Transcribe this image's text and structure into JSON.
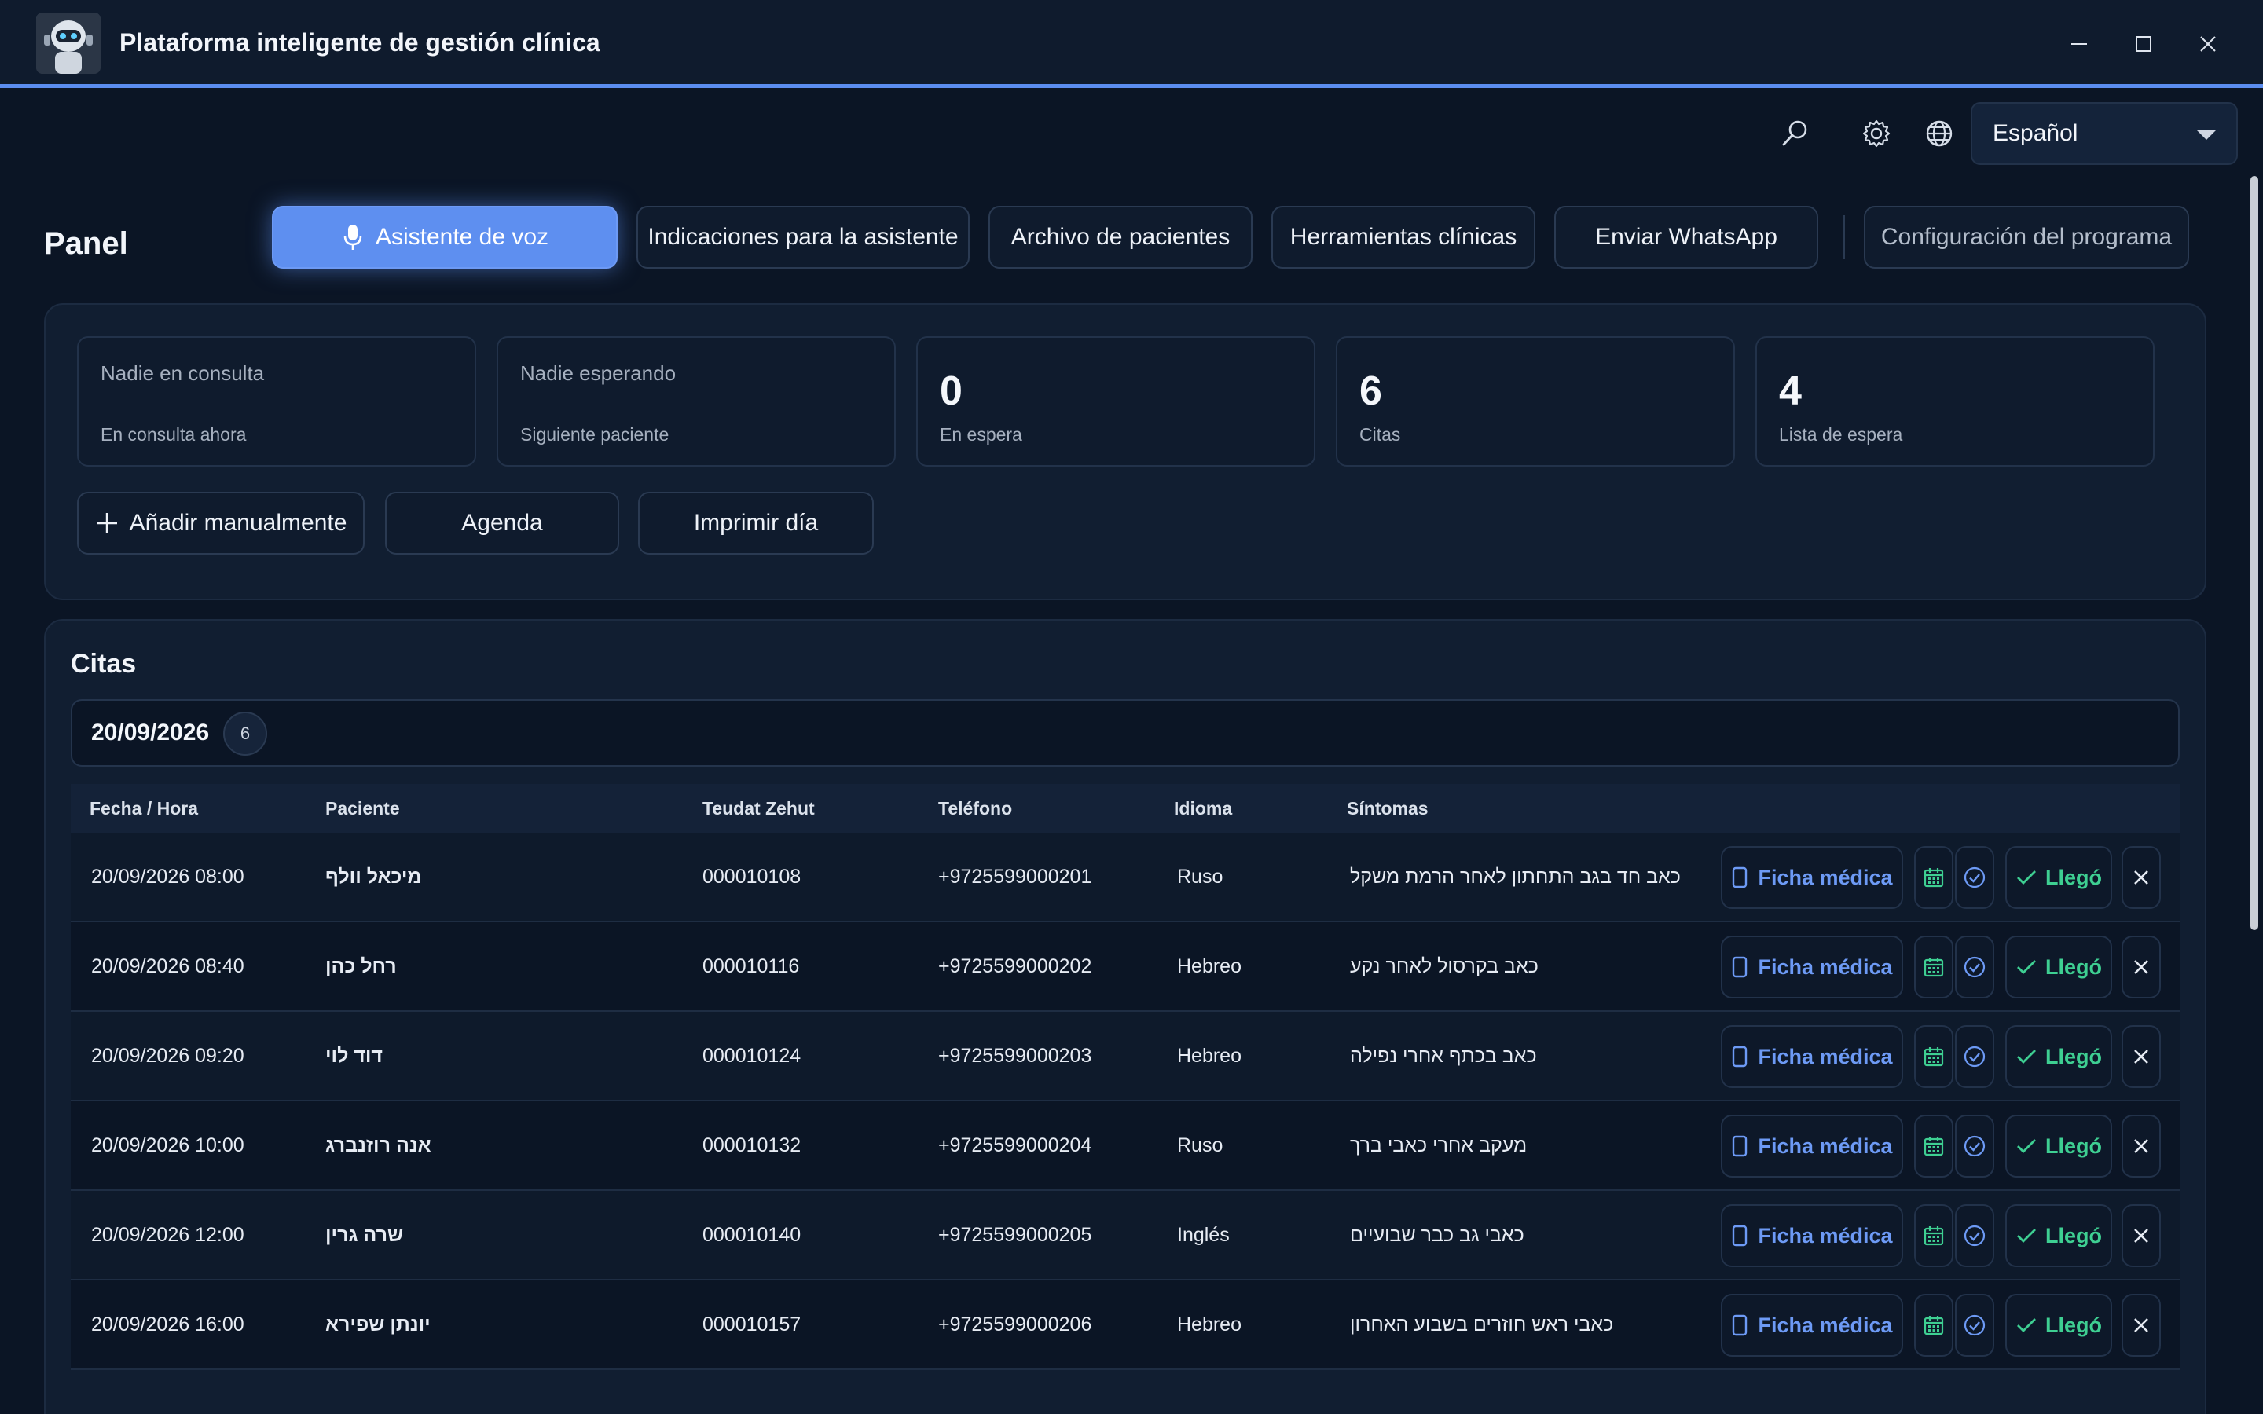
{
  "window": {
    "title": "Plataforma inteligente de gestión clínica"
  },
  "toolbar": {
    "language": "Español",
    "icons": [
      "search-icon",
      "gear-icon",
      "globe-icon"
    ]
  },
  "nav": {
    "panel_title": "Panel",
    "voice_assistant": "Asistente de voz",
    "assistant_instructions": "Indicaciones para la asistente",
    "patient_archive": "Archivo de pacientes",
    "clinical_tools": "Herramientas clínicas",
    "send_whatsapp": "Enviar WhatsApp",
    "program_settings": "Configuración del programa"
  },
  "stats": {
    "in_consult_main": "Nadie en consulta",
    "in_consult_sub": "En consulta ahora",
    "next_main": "Nadie esperando",
    "next_sub": "Siguiente paciente",
    "waiting_num": "0",
    "waiting_label": "En espera",
    "appts_num": "6",
    "appts_label": "Citas",
    "waitlist_num": "4",
    "waitlist_label": "Lista de espera"
  },
  "actions": {
    "add_manual": "Añadir manualmente",
    "agenda": "Agenda",
    "print_day": "Imprimir día"
  },
  "appointments": {
    "title": "Citas",
    "date": "20/09/2026",
    "count": "6",
    "columns": [
      "Fecha / Hora",
      "Paciente",
      "Teudat Zehut",
      "Teléfono",
      "Idioma",
      "Síntomas"
    ],
    "record_label": "Ficha médica",
    "arrived_label": "Llegó",
    "rows": [
      {
        "datetime": "20/09/2026 08:00",
        "patient": "מיכאל וולף",
        "id": "000010108",
        "phone": "+9725599000201",
        "language": "Ruso",
        "symptoms": "כאב חד בגב התחתון לאחר הרמת משקל"
      },
      {
        "datetime": "20/09/2026 08:40",
        "patient": "רחל כהן",
        "id": "000010116",
        "phone": "+9725599000202",
        "language": "Hebreo",
        "symptoms": "כאב בקרסול לאחר נקע"
      },
      {
        "datetime": "20/09/2026 09:20",
        "patient": "דוד לוי",
        "id": "000010124",
        "phone": "+9725599000203",
        "language": "Hebreo",
        "symptoms": "כאב בכתף אחרי נפילה"
      },
      {
        "datetime": "20/09/2026 10:00",
        "patient": "אנה רוזנברג",
        "id": "000010132",
        "phone": "+9725599000204",
        "language": "Ruso",
        "symptoms": "מעקב אחרי כאבי ברך"
      },
      {
        "datetime": "20/09/2026 12:00",
        "patient": "שרה גרין",
        "id": "000010140",
        "phone": "+9725599000205",
        "language": "Inglés",
        "symptoms": "כאבי גב כבר שבועיים"
      },
      {
        "datetime": "20/09/2026 16:00",
        "patient": "יונתן שפירא",
        "id": "000010157",
        "phone": "+9725599000206",
        "language": "Hebreo",
        "symptoms": "כאבי ראש חוזרים בשבוע האחרון"
      }
    ]
  },
  "colors": {
    "accent": "#5e8ff0",
    "success": "#3ecf92",
    "background": "#0b1525"
  }
}
